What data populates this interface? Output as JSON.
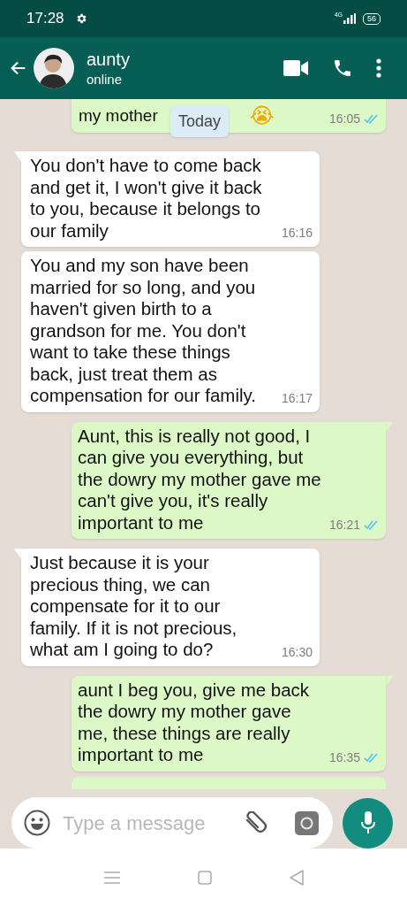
{
  "status_bar": {
    "time": "17:28",
    "network": "4G",
    "battery": "56"
  },
  "header": {
    "name": "aunty",
    "status": "online"
  },
  "date_pill": "Today",
  "messages": [
    {
      "kind": "partial_out",
      "text": "my mother",
      "emoji": "😭",
      "time": "16:05",
      "read": true
    },
    {
      "kind": "in",
      "text": "You don't have to come back and get it, I won't give it back to you, because it belongs to our family",
      "time": "16:16",
      "tail": true
    },
    {
      "kind": "in",
      "text": "You and my son have been married for so long, and you haven't given birth to a grandson for me. You don't want to take these things back, just treat them as compensation for our family.",
      "time": "16:17",
      "tail": false
    },
    {
      "kind": "out",
      "text": "Aunt, this is really not good, I can give you everything, but the dowry my mother gave me can't give you, it's really important to me",
      "time": "16:21",
      "read": true,
      "tail": true
    },
    {
      "kind": "in",
      "text": "Just because it is your precious thing, we can compensate for it to our family. If it is not precious, what am I going to do?",
      "time": "16:30",
      "tail": true
    },
    {
      "kind": "out",
      "text": "aunt I beg you, give me back the dowry my mother gave me, these things are really important to me",
      "time": "16:35",
      "read": true,
      "tail": true
    },
    {
      "kind": "cut_out"
    }
  ],
  "composer": {
    "placeholder": "Type a message"
  }
}
